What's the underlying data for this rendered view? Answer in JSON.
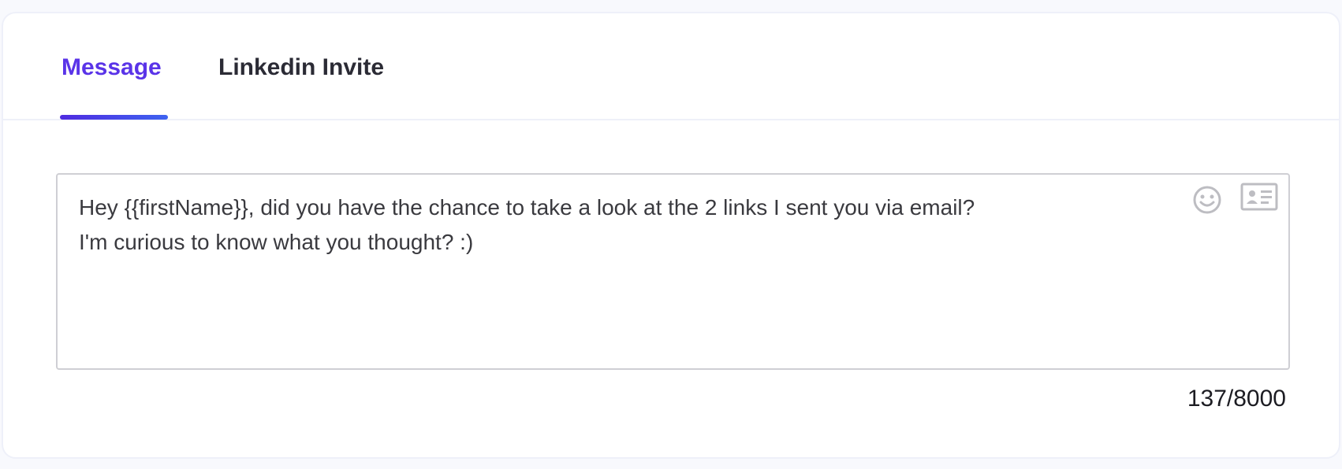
{
  "tabs": {
    "message_label": "Message",
    "linkedin_label": "Linkedin Invite",
    "active": "Message"
  },
  "editor": {
    "text": "Hey {{firstName}}, did you have the chance to take a look at the 2 links I sent you via email?\nI'm curious to know what you thought? :)",
    "tools": [
      "smiley-icon",
      "contact-card-icon"
    ]
  },
  "counter": {
    "text": "137/8000"
  },
  "colors": {
    "accent": "#5a34e8",
    "accent_end": "#3e63f0",
    "border": "#cfcfd4",
    "icon": "#bdbdc2"
  }
}
